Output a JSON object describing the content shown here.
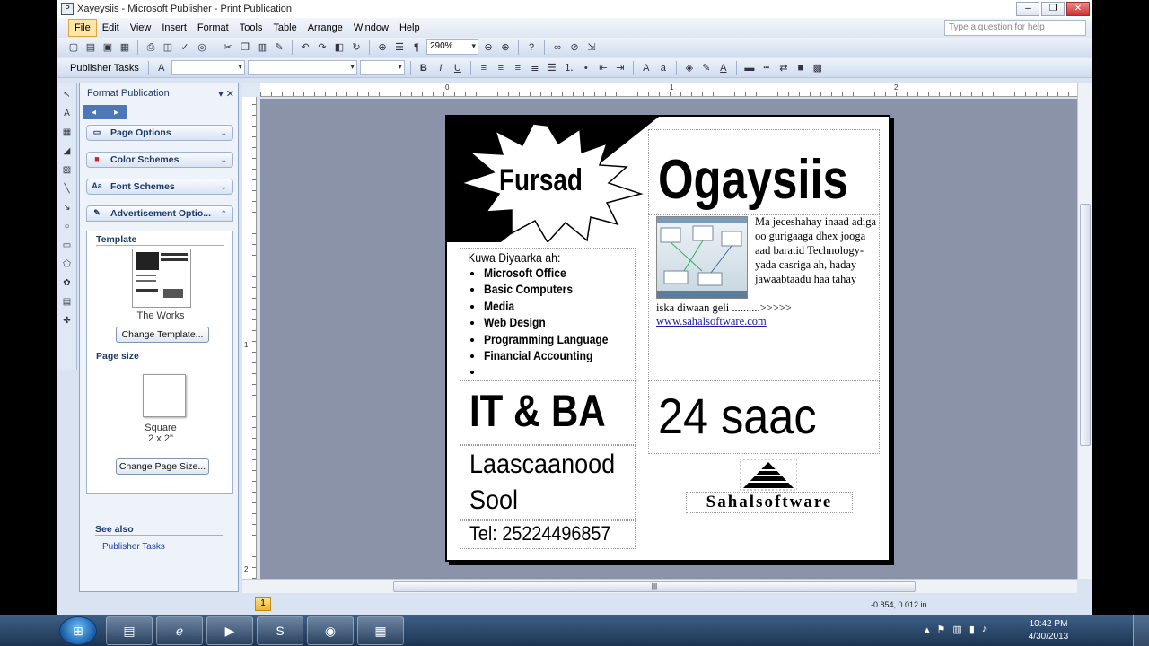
{
  "window": {
    "title": "Xayeysiis - Microsoft Publisher - Print Publication",
    "controls": [
      "–",
      "❐",
      "✕"
    ]
  },
  "menu": {
    "items": [
      "File",
      "Edit",
      "View",
      "Insert",
      "Format",
      "Tools",
      "Table",
      "Arrange",
      "Window",
      "Help"
    ],
    "active": "File",
    "help_placeholder": "Type a question for help"
  },
  "toolbar": {
    "zoom": "290%",
    "publisher_tasks": "Publisher Tasks"
  },
  "taskpane": {
    "title": "Format Publication",
    "sections": [
      "Page Options",
      "Color Schemes",
      "Font Schemes",
      "Advertisement Optio..."
    ],
    "template_label": "Template",
    "template_name": "The Works",
    "change_template_button": "Change Template...",
    "page_size_label": "Page size",
    "page_size_name": "Square",
    "page_size_dims": "2 x 2\"",
    "change_page_size_button": "Change Page Size...",
    "see_also_label": "See also",
    "see_also_link": "Publisher Tasks"
  },
  "rulers": {
    "h_marks": [
      "0",
      "1",
      "2"
    ],
    "v_marks": [
      "1",
      "2"
    ]
  },
  "publication": {
    "burst_text": "Fursad",
    "title": "Ogaysiis",
    "list_heading": "Kuwa Diyaarka ah:",
    "list_items": [
      "Microsoft Office",
      "Basic Computers",
      "Media",
      "Web Design",
      "Programming Language",
      "Financial Accounting",
      ""
    ],
    "description": "Ma jeceshahay inaad adiga oo gurigaaga dhex jooga aad baratid Technology-yada casriga ah, haday jawaabtaadu haa tahay",
    "description_tail": "iska diwaan geli ..........>>>>>",
    "website": "www.sahalsoftware.com",
    "big_left": "IT & BA",
    "big_right": "24 saac",
    "location_line1": "Laascaanood",
    "location_line2": "Sool",
    "phone": "Tel: 25224496857",
    "logo_text": "Sahalsoftware"
  },
  "status": {
    "page_number": "1",
    "coordinates": "-0.854, 0.012 in."
  },
  "taskbar": {
    "time": "10:42 PM",
    "date": "4/30/2013"
  },
  "colors": {
    "accent": "#fde7a8",
    "chrome": "#d9e3f2",
    "canvas": "#8a93a8",
    "taskbar": "#1c3453"
  }
}
